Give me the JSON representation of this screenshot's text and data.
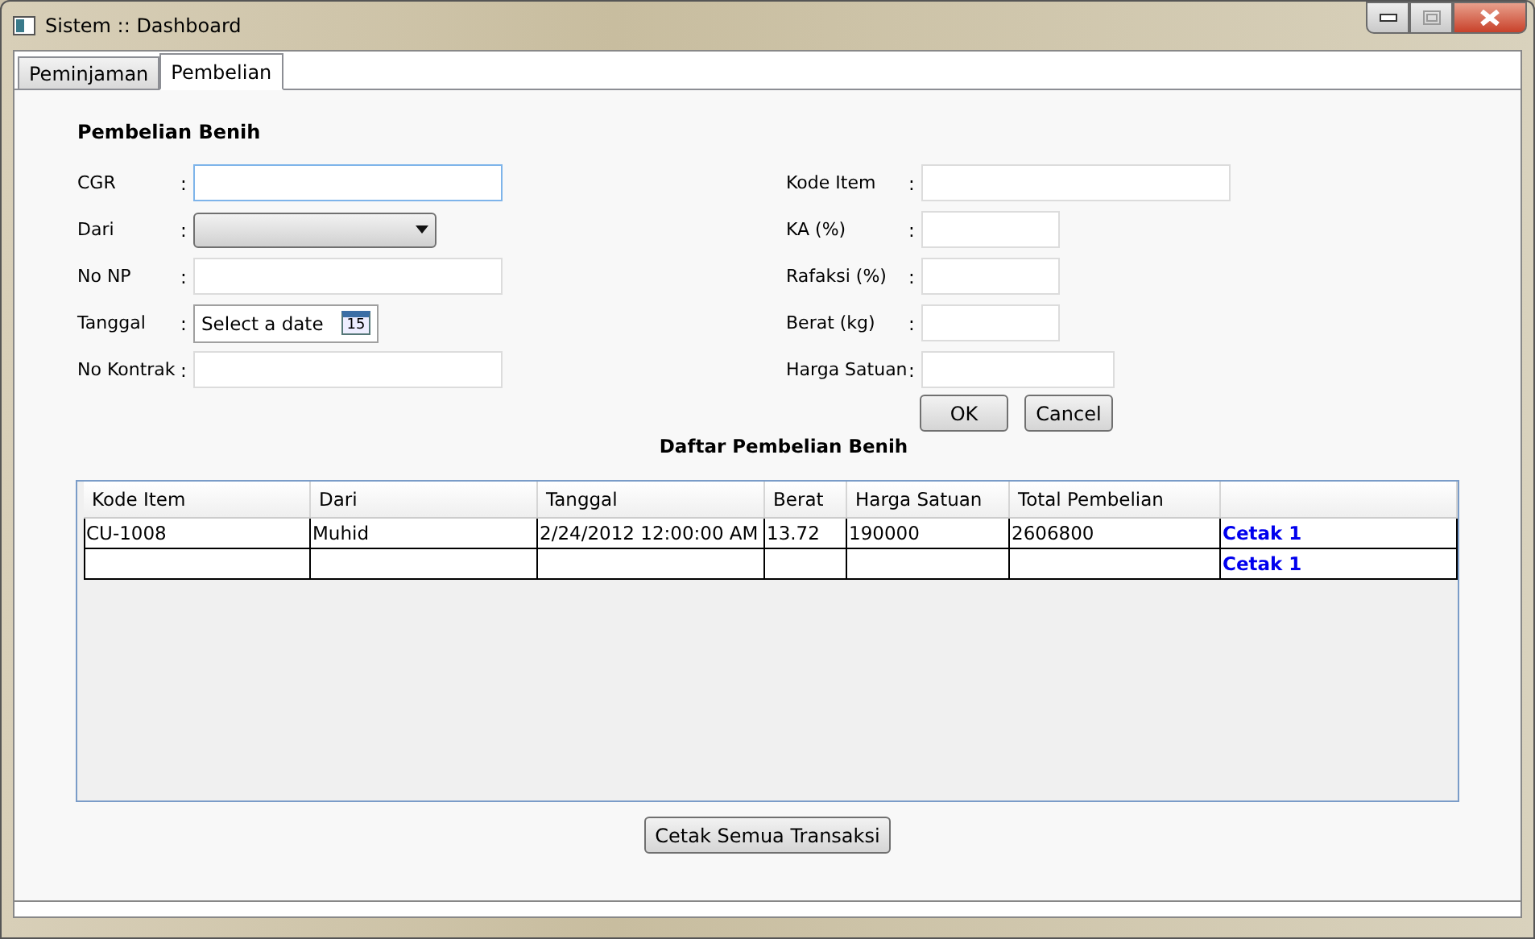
{
  "window": {
    "title": "Sistem :: Dashboard"
  },
  "tabs": [
    {
      "label": "Peminjaman",
      "selected": false
    },
    {
      "label": "Pembelian",
      "selected": true
    }
  ],
  "form": {
    "heading": "Pembelian Benih",
    "left_fields": [
      {
        "label": "CGR",
        "separator": ":",
        "kind": "text",
        "focused": true
      },
      {
        "label": "Dari",
        "separator": ":",
        "kind": "combo",
        "focused": false
      },
      {
        "label": "No NP",
        "separator": ":",
        "kind": "text",
        "focused": false
      },
      {
        "label": "Tanggal",
        "separator": ":",
        "kind": "date",
        "placeholder": "Select a date",
        "date_icon": "15",
        "focused": false
      },
      {
        "label": "No Kontrak",
        "separator": ":",
        "kind": "text",
        "focused": false
      }
    ],
    "right_fields": [
      {
        "label": "Kode Item",
        "separator": ":",
        "kind": "wide",
        "focused": false
      },
      {
        "label": "KA (%)",
        "separator": ":",
        "kind": "short",
        "focused": false
      },
      {
        "label": "Rafaksi (%)",
        "separator": ":",
        "kind": "short",
        "focused": false
      },
      {
        "label": "Berat (kg)",
        "separator": ":",
        "kind": "short",
        "focused": false
      },
      {
        "label": "Harga Satuan",
        "separator": ":",
        "kind": "medium",
        "focused": false
      }
    ],
    "buttons": [
      "OK",
      "Cancel"
    ]
  },
  "table": {
    "title": "Daftar Pembelian Benih",
    "columns": [
      "Kode Item",
      "Dari",
      "Tanggal",
      "Berat",
      "Harga Satuan",
      "Total Pembelian"
    ],
    "rows": [
      {
        "cells": [
          "CU-1008",
          "Muhid",
          "2/24/2012 12:00:00 AM",
          "13.72",
          "190000",
          "2606800"
        ],
        "action": "Cetak 1"
      },
      {
        "cells": [],
        "action": "Cetak 1"
      }
    ]
  },
  "print_all_button": "Cetak Semua Transaksi"
}
